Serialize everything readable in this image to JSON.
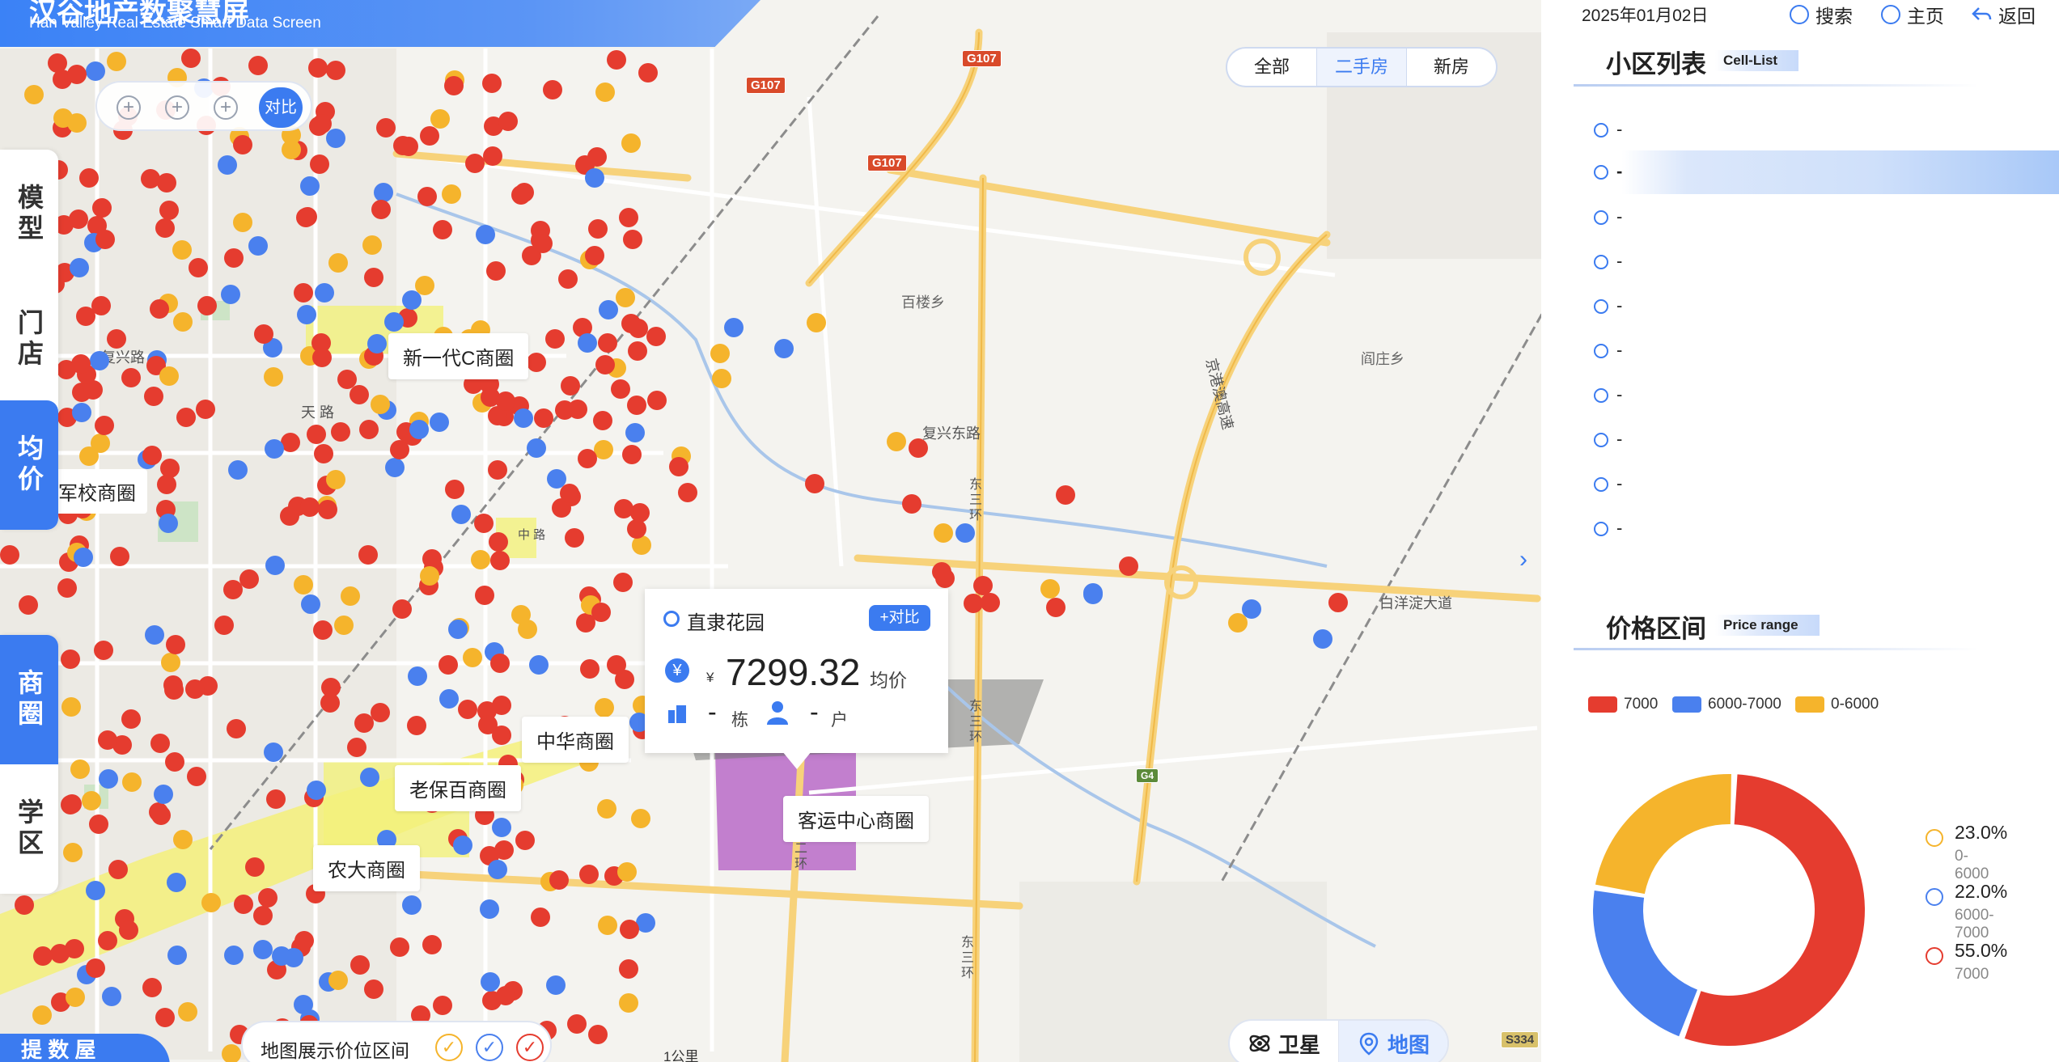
{
  "header": {
    "title": "汉谷地产数聚慧屏",
    "subtitle": "Han Valley Real Estate Smart Data Screen"
  },
  "compare_toolbar": {
    "plus": "+",
    "compare_label": "对比"
  },
  "left_nav": [
    {
      "label": "模型",
      "active": false
    },
    {
      "label": "门店",
      "active": false
    },
    {
      "label": "均价",
      "active": true
    },
    {
      "label": "商圈",
      "active": true
    },
    {
      "label": "学区",
      "active": false
    }
  ],
  "house_type_tabs": [
    {
      "label": "全部",
      "selected": false
    },
    {
      "label": "二手房",
      "selected": true
    },
    {
      "label": "新房",
      "selected": false
    }
  ],
  "map": {
    "road_labels": [
      "复兴路",
      "复兴东路",
      "京港澳高速",
      "白洋淀大道",
      "东三环",
      "东三环",
      "东三环",
      "二环",
      "天 路",
      "中 路"
    ],
    "shields": [
      "G107",
      "G107",
      "G107",
      "G4",
      "S334"
    ],
    "pois": [
      "百楼乡",
      "阎庄乡"
    ],
    "districts": [
      "新一代C商圈",
      "军校商圈",
      "中华商圈",
      "老保百商圈",
      "客运中心商圈",
      "农大商圈"
    ],
    "scale": "1公里",
    "dot_colors": {
      "high": "#e53c2f",
      "mid": "#4a80ee",
      "low": "#f5b42c"
    }
  },
  "popup": {
    "name": "直隶花园",
    "compare": "+对比",
    "yen_icon": "¥",
    "currency": "¥",
    "price": "7299.32",
    "price_label": "均价",
    "buildings": "-",
    "buildings_unit": "栋",
    "households": "-",
    "households_unit": "户"
  },
  "range_legend": {
    "label": "地图展示价位区间",
    "checks": [
      {
        "color": "#f5b42c",
        "checked": true
      },
      {
        "color": "#4a80ee",
        "checked": true
      },
      {
        "color": "#e53c2f",
        "checked": true
      }
    ]
  },
  "map_toggle": {
    "satellite": "卫星",
    "map": "地图",
    "selected": "地图"
  },
  "bottom_tab": "提 数 屋",
  "topbar": {
    "date": "2025年01月02日",
    "search": "搜索",
    "home": "主页",
    "back": "返回"
  },
  "cell_list": {
    "title": "小区列表",
    "subtitle": "Cell-List",
    "rows": [
      "-",
      "-",
      "-",
      "-",
      "-",
      "-",
      "-",
      "-",
      "-",
      "-"
    ],
    "selected_index": 1
  },
  "price_range": {
    "title": "价格区间",
    "subtitle": "Price range",
    "legend": [
      {
        "label": "7000",
        "color": "#e53c2f"
      },
      {
        "label": "6000-7000",
        "color": "#4a80ee"
      },
      {
        "label": "0-6000",
        "color": "#f5b42c"
      }
    ],
    "chart_data": {
      "type": "pie",
      "donut": true,
      "categories": [
        "7000",
        "6000-7000",
        "0-6000"
      ],
      "values": [
        55.0,
        22.0,
        23.0
      ],
      "colors": [
        "#e53c2f",
        "#4a80ee",
        "#f5b42c"
      ]
    },
    "breakdown": [
      {
        "pct": "23.0%",
        "range": "0-6000",
        "color": "#f5b42c"
      },
      {
        "pct": "22.0%",
        "range": "6000-7000",
        "color": "#4a80ee"
      },
      {
        "pct": "55.0%",
        "range": "7000",
        "color": "#e53c2f"
      }
    ]
  }
}
